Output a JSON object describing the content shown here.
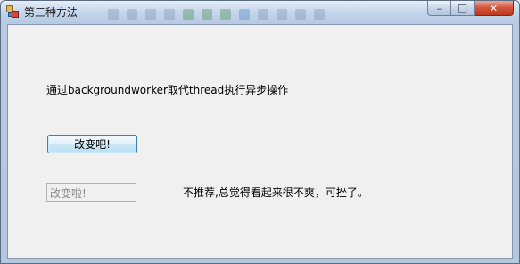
{
  "window": {
    "title": "第三种方法",
    "minimize_glyph": "–",
    "maximize_glyph": "□",
    "close_glyph": "✕",
    "accent": "#c0391f"
  },
  "form": {
    "description": "通过backgroundworker取代thread执行异步操作",
    "change_button_label": "改变吧!",
    "status_textbox_value": "改变啦!",
    "note_text": "不推荐,总觉得看起来很不爽，可挫了。"
  }
}
